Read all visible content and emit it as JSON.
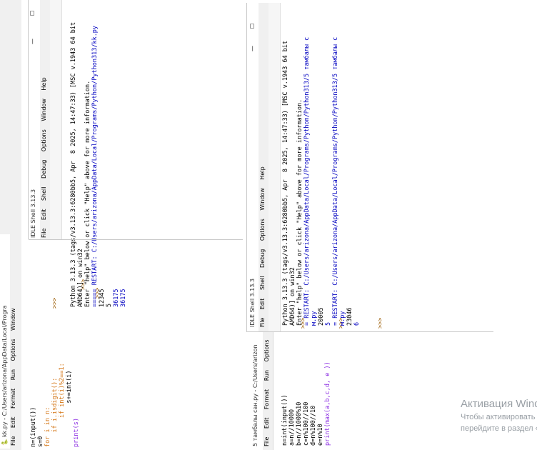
{
  "editor1": {
    "title": "kk.py - C:/Users/arizona/AppData/Local/Progra",
    "menu": [
      "File",
      "Edit",
      "Format",
      "Run",
      "Options",
      "Window"
    ],
    "code": [
      "n=(input())",
      "s=0",
      "for i in n:",
      "    if i.isdigit():",
      "        if int(i)%2==1:",
      "            s+=int(i)",
      "",
      "print(s)"
    ]
  },
  "shell1": {
    "title": "IDLE Shell 3.13.3",
    "menu": [
      "File",
      "Edit",
      "Shell",
      "Debug",
      "Options",
      "Window",
      "Help"
    ],
    "window_controls": [
      "—",
      "☐"
    ],
    "lines": [
      "Python 3.13.3 (tags/v3.13.3:6280bb5, Apr  8 2025, 14:47:33) [MSC v.1943 64 bit",
      "AMD64)] on win32",
      "Enter \"help\" below or click \"Help\" above for more information.",
      "",
      "===== RESTART: C:/Users/arizona/AppData/Local/Programs/Python/Python313/kk.py",
      "12345",
      "5",
      "36175",
      "36175"
    ],
    "prompts": [
      ">>>",
      ">>>",
      ">>>"
    ]
  },
  "editor2": {
    "title": "5 тамбалы сан.py - C:/Users/arizon",
    "menu": [
      "File",
      "Edit",
      "Format",
      "Run",
      "Options"
    ],
    "code": [
      "n=int(input())",
      "a=n//10000",
      "b=n//1000%10",
      "c=n%100//100",
      "d=n%100//10",
      "e=n%10",
      "print(max(a,b,c,d, e ))"
    ]
  },
  "shell2": {
    "title": "IDLE Shell 3.13.3",
    "menu": [
      "File",
      "Edit",
      "Shell",
      "Debug",
      "Options",
      "Window",
      "Help"
    ],
    "window_controls": [
      "—",
      "☐"
    ],
    "lines": [
      "Python 3.13.3 (tags/v3.13.3:6280bb5, Apr  8 2025, 14:47:33) [MSC v.1943 64 bit",
      "AMD64)] on win32",
      "Enter \"help\" below or click \"Help\" above for more information.",
      "",
      "= RESTART: C:/Users/arizona/AppData/Local/Programs/Python/Python313/5 тамбалы с",
      "м.py",
      "20005",
      "5",
      "",
      "= RESTART: C:/Users/arizona/AppData/Local/Programs/Python/Python313/5 тамбалы с",
      "м.py",
      "23046",
      "6"
    ],
    "prompts": [
      ">>>",
      ">>>",
      ">>>"
    ]
  },
  "activation": {
    "title": "Активация Windows",
    "line1": "Чтобы активировать Windows,",
    "line2": "перейдите в раздел «Параметры»."
  }
}
